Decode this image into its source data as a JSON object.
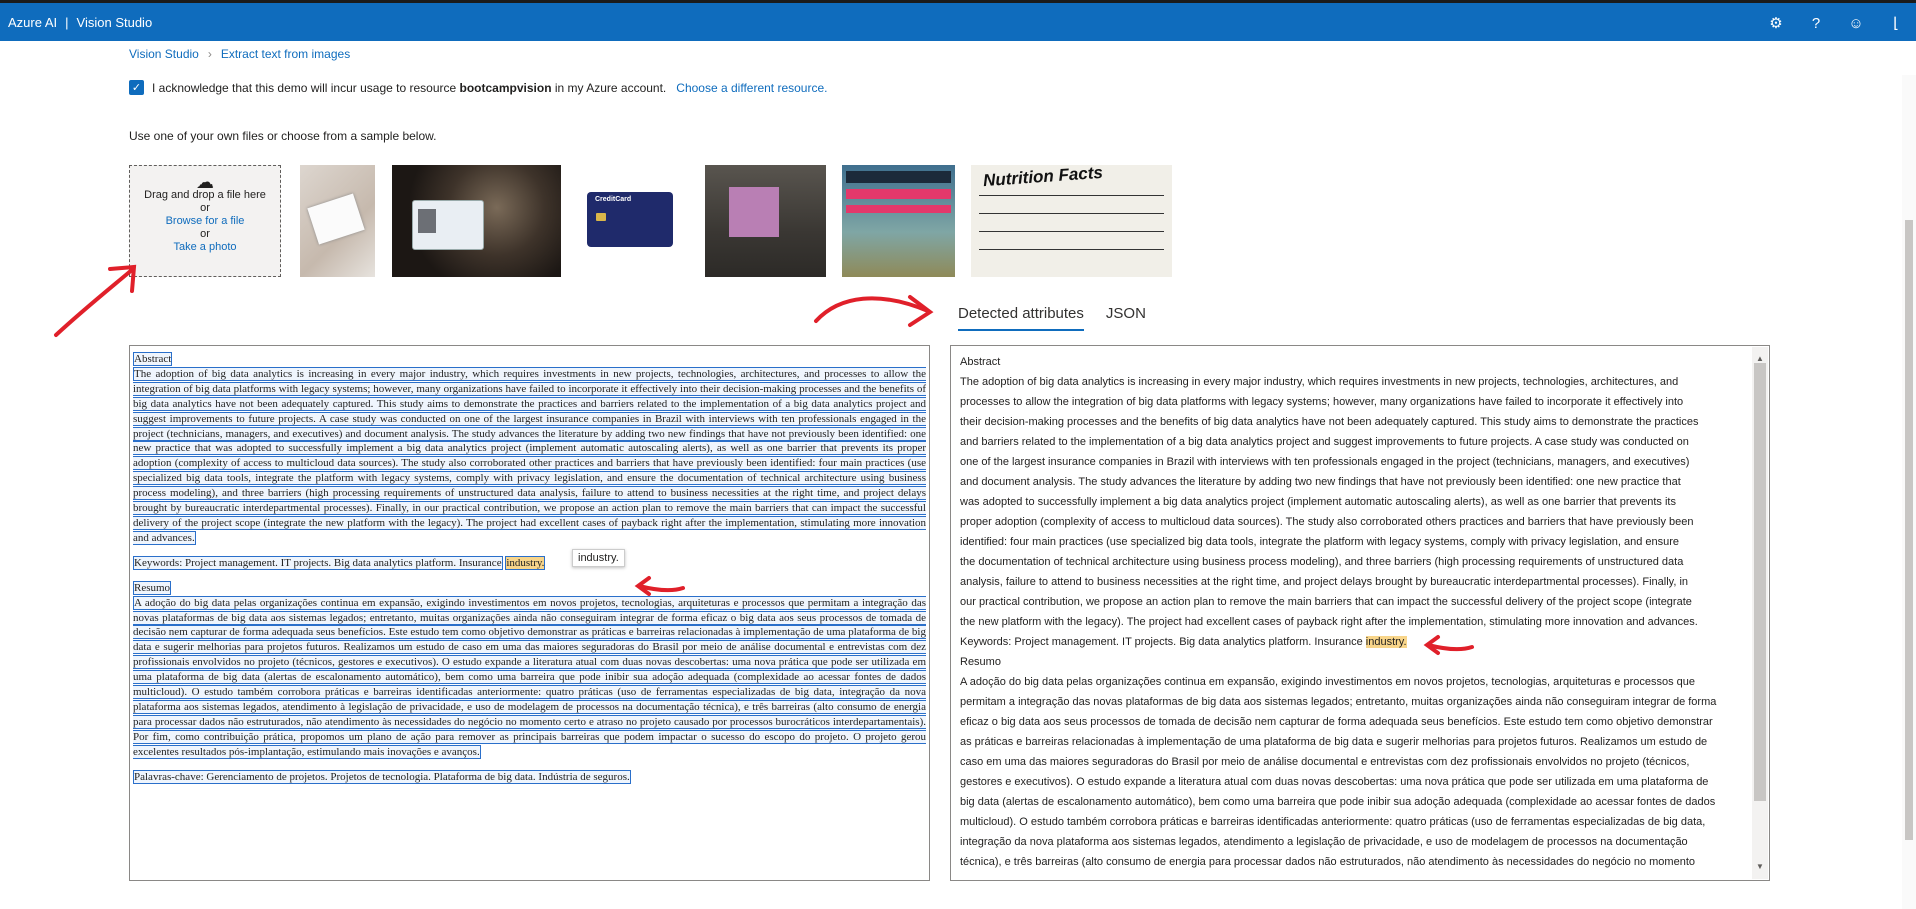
{
  "app": {
    "brand": "Azure AI",
    "product": "Vision Studio"
  },
  "topbar_icons": [
    "gear-icon",
    "help-icon",
    "feedback-icon",
    "account-icon"
  ],
  "breadcrumb": {
    "root": "Vision Studio",
    "current": "Extract text from images"
  },
  "acknowledge": {
    "prefix": "I acknowledge that this demo will incur usage to resource",
    "resource": "bootcampvision",
    "suffix": "in my Azure account.",
    "link": "Choose a different resource."
  },
  "use_own": "Use one of your own files or choose from a sample below.",
  "upload": {
    "drag": "Drag and drop a file here",
    "or1": "or",
    "browse": "Browse for a file",
    "or2": "or",
    "photo": "Take a photo"
  },
  "thumbs": {
    "credit_brand": "CreditCard",
    "nf_title": "Nutrition Facts"
  },
  "tabs": [
    "Detected attributes",
    "JSON"
  ],
  "doc": {
    "title": "Abstract",
    "abstract": "The adoption of big data analytics is increasing in every major industry, which requires investments in new projects, technologies, architectures, and processes to allow the integration of big data platforms with legacy systems; however, many organizations have failed to incorporate it effectively into their decision-making processes and the benefits of big data analytics have not been adequately captured. This study aims to demonstrate the practices and barriers related to the implementation of a big data analytics project and suggest improvements to future projects. A case study was conducted on one of the largest insurance companies in Brazil with interviews with ten professionals engaged in the project (technicians, managers, and executives) and document analysis. The study advances the literature by adding two new findings that have not previously been identified: one new practice that was adopted to successfully implement a big data analytics project (implement automatic autoscaling alerts), as well as one barrier that prevents its proper adoption (complexity of access to multicloud data sources). The study also corroborated other practices and barriers that have previously been identified: four main practices (use specialized big data tools, integrate the platform with legacy systems, comply with privacy legislation, and ensure the documentation of technical architecture using business process modeling), and three barriers (high processing requirements of unstructured data analysis, failure to attend to business necessities at the right time, and project delays brought by bureaucratic interdepartmental processes). Finally, in our practical contribution, we propose an action plan to remove the main barriers that can impact the successful delivery of the project scope (integrate the new platform with the legacy). The project had excellent cases of payback right after the implementation, stimulating more innovation and advances.",
    "keywords": "Keywords: Project management. IT projects. Big data analytics platform. Insurance",
    "keyword_hl": "industry.",
    "tooltip": "industry.",
    "resumo_title": "Resumo",
    "resumo": "A adoção do big data pelas organizações continua em expansão, exigindo investimentos em novos projetos, tecnologias, arquiteturas e processos que permitam a integração das novas plataformas de big data aos sistemas legados; entretanto, muitas organizações ainda não conseguiram integrar de forma eficaz o big data aos seus processos de tomada de decisão nem capturar de forma adequada seus benefícios. Este estudo tem como objetivo demonstrar as práticas e barreiras relacionadas à implementação de uma plataforma de big data e sugerir melhorias para projetos futuros. Realizamos um estudo de caso em uma das maiores seguradoras do Brasil por meio de análise documental e entrevistas com dez profissionais envolvidos no projeto (técnicos, gestores e executivos). O estudo expande a literatura atual com duas novas descobertas: uma nova prática que pode ser utilizada em uma plataforma de big data (alertas de escalonamento automático), bem como uma barreira que pode inibir sua adoção adequada (complexidade ao acessar fontes de dados multicloud). O estudo também corrobora práticas e barreiras identificadas anteriormente: quatro práticas (uso de ferramentas especializadas de big data, integração da nova plataforma aos sistemas legados, atendimento à legislação de privacidade, e uso de modelagem de processos na documentação técnica), e três barreiras (alto consumo de energia para processar dados não estruturados, não atendimento às necessidades do negócio no momento certo e atraso no projeto causado por processos burocráticos interdepartamentais). Por fim, como contribuição prática, propomos um plano de ação para remover as principais barreiras que podem impactar o sucesso do escopo do projeto. O projeto gerou excelentes resultados pós-implantação, estimulando mais inovações e avanços.",
    "palavras": "Palavras-chave: Gerenciamento de projetos. Projetos de tecnologia. Plataforma de big data. Indústria de seguros."
  },
  "results": {
    "lines": [
      "Abstract",
      "The adoption of big data analytics is increasing in every major industry, which requires investments in new projects, technologies, architectures, and",
      "processes to allow the integration of big data platforms with legacy systems; however, many organizations have failed to incorporate it effectively into",
      "their decision-making processes and the benefits of big data analytics have not been adequately captured. This study aims to demonstrate the practices",
      "and barriers related to the implementation of a big data analytics project and suggest improvements to future projects. A case study was conducted on",
      "one of the largest insurance companies in Brazil with interviews with ten professionals engaged in the project (technicians, managers, and executives)",
      "and document analysis. The study advances the literature by adding two new findings that have not previously been identified: one new practice that",
      "was adopted to successfully implement a big data analytics project (implement automatic autoscaling alerts), as well as one barrier that prevents its",
      "proper adoption (complexity of access to multicloud data sources). The study also corroborated others practices and barriers that have previously been",
      "identified: four main practices (use specialized big data tools, integrate the platform with legacy systems, comply with privacy legislation, and ensure",
      "the documentation of technical architecture using business process modeling), and three barriers (high processing requirements of unstructured data",
      "analysis, failure to attend to business necessities at the right time, and project delays brought by bureaucratic interdepartmental processes). Finally, in",
      "our practical contribution, we propose an action plan to remove the main barriers that can impact the successful delivery of the project scope (integrate",
      "the new platform with the legacy). The project had excellent cases of payback right after the implementation, stimulating more innovation and advances."
    ],
    "keywords": "Keywords: Project management. IT projects. Big data analytics platform. Insurance",
    "keyword_hl": "industry.",
    "resumo_lines": [
      "Resumo",
      "A adoção do big data pelas organizações continua em expansão, exigindo investimentos em novos projetos, tecnologias, arquiteturas e processos que",
      "permitam a integração das novas plataformas de big data aos sistemas legados; entretanto, muitas organizações ainda não conseguiram integrar de forma",
      "eficaz o big data aos seus processos de tomada de decisão nem capturar de forma adequada seus benefícios. Este estudo tem como objetivo demonstrar",
      "as práticas e barreiras relacionadas à implementação de uma plataforma de big data e sugerir melhorias para projetos futuros. Realizamos um estudo de",
      "caso em uma das maiores seguradoras do Brasil por meio de análise documental e entrevistas com dez profissionais envolvidos no projeto (técnicos,",
      "gestores e executivos). O estudo expande a literatura atual com duas novas descobertas: uma nova prática que pode ser utilizada em uma plataforma de",
      "big data (alertas de escalonamento automático), bem como uma barreira que pode inibir sua adoção adequada (complexidade ao acessar fontes de dados",
      "multicloud). O estudo também corrobora práticas e barreiras identificadas anteriormente: quatro práticas (uso de ferramentas especializadas de big data,",
      "integração da nova plataforma aos sistemas legados, atendimento a legislação de privacidade, e uso de modelagem de processos na documentação",
      "técnica), e três barreiras (alto consumo de energia para processar dados não estruturados, não atendimento às necessidades do negócio no momento"
    ]
  }
}
